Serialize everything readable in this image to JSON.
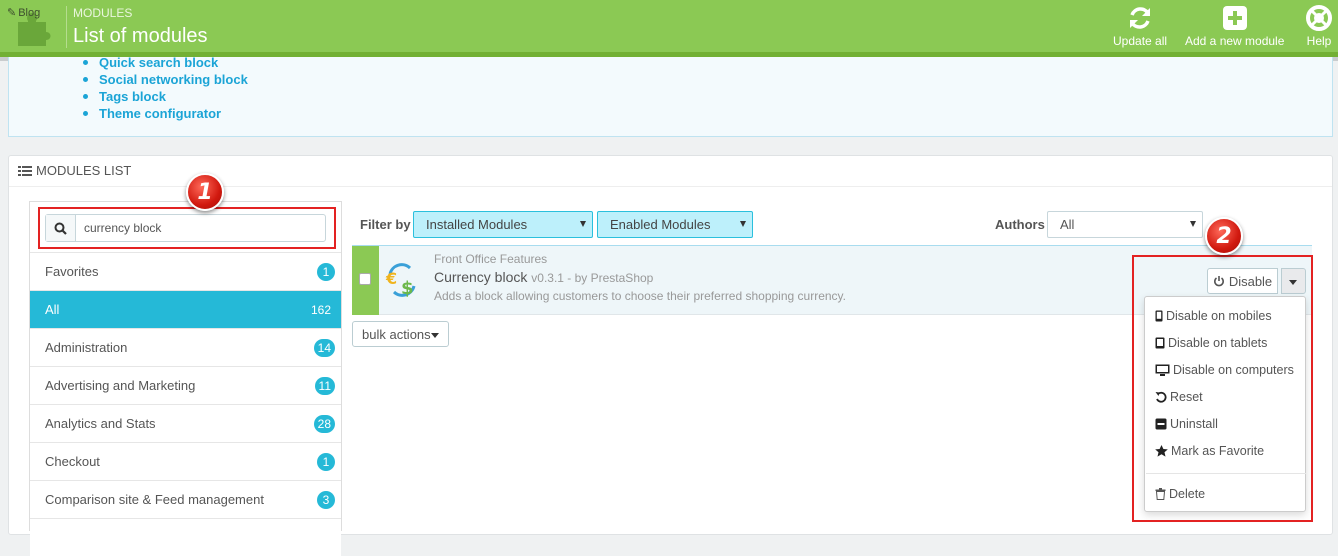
{
  "header": {
    "blog_label": "Blog",
    "breadcrumb": "MODULES",
    "title": "List of modules",
    "toolbar": [
      {
        "label": "Update all",
        "icon": "refresh-icon"
      },
      {
        "label": "Add a new module",
        "icon": "plus-square-icon"
      },
      {
        "label": "Help",
        "icon": "lifebuoy-icon"
      }
    ]
  },
  "suggested_modules": [
    "Quick search block",
    "Social networking block",
    "Tags block",
    "Theme configurator"
  ],
  "modules_panel": {
    "heading": "MODULES LIST",
    "search": {
      "value": "currency block",
      "placeholder": ""
    },
    "categories": [
      {
        "label": "Favorites",
        "count": "1",
        "active": false
      },
      {
        "label": "All",
        "count": "162",
        "active": true
      },
      {
        "label": "Administration",
        "count": "14",
        "active": false
      },
      {
        "label": "Advertising and Marketing",
        "count": "11",
        "active": false
      },
      {
        "label": "Analytics and Stats",
        "count": "28",
        "active": false
      },
      {
        "label": "Checkout",
        "count": "1",
        "active": false
      },
      {
        "label": "Comparison site & Feed management",
        "count": "3",
        "active": false
      }
    ]
  },
  "filters": {
    "label": "Filter by",
    "installed": "Installed Modules",
    "enabled": "Enabled Modules",
    "authors_label": "Authors",
    "authors_value": "All"
  },
  "module": {
    "category": "Front Office Features",
    "name": "Currency block",
    "version": "v0.3.1 - by PrestaShop",
    "description": "Adds a block allowing customers to choose their preferred shopping currency.",
    "action_label": "Disable"
  },
  "bulk_label": "bulk actions",
  "dropdown": [
    {
      "label": "Disable on mobiles",
      "icon": "mobile-icon"
    },
    {
      "label": "Disable on tablets",
      "icon": "tablet-icon"
    },
    {
      "label": "Disable on computers",
      "icon": "desktop-icon"
    },
    {
      "label": "Reset",
      "icon": "undo-icon"
    },
    {
      "label": "Uninstall",
      "icon": "minus-square-icon"
    },
    {
      "label": "Mark as Favorite",
      "icon": "star-icon"
    },
    {
      "label": "Delete",
      "icon": "trash-icon"
    }
  ],
  "annotations": {
    "marker_1": "1",
    "marker_2": "2"
  },
  "colors": {
    "header_green": "#8bc954",
    "accent_blue": "#25b9d7",
    "annotation_red": "#e32222"
  }
}
